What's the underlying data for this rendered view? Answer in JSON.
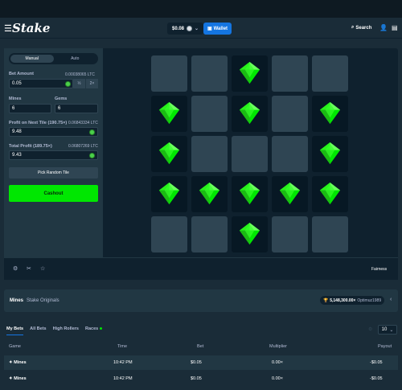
{
  "header": {
    "logo": "Stake",
    "balance": "$0.08",
    "wallet": "Wallet",
    "search": "Search"
  },
  "sidebar": {
    "tabs": [
      "Manual",
      "Auto"
    ],
    "bet_amount_label": "Bet Amount",
    "bet_amount_ltc": "0.00038065 LTC",
    "bet_amount_value": "0.05",
    "half": "½",
    "double": "2×",
    "mines_label": "Mines",
    "mines_value": "6",
    "gems_label": "Gems",
    "gems_value": "6",
    "next_label": "Profit on Next Tile (190.75×)",
    "next_ltc": "0.06843334 LTC",
    "next_value": "9.48",
    "total_label": "Total Profit (189.75×)",
    "total_ltc": "0.06807269 LTC",
    "total_value": "9.43",
    "pick_random": "Pick Random Tile",
    "cashout": "Cashout"
  },
  "grid": [
    [
      0,
      0,
      1,
      0,
      0
    ],
    [
      1,
      0,
      1,
      0,
      1
    ],
    [
      1,
      0,
      0,
      0,
      1
    ],
    [
      1,
      1,
      1,
      1,
      1
    ],
    [
      0,
      0,
      1,
      0,
      0
    ]
  ],
  "footer": {
    "fairness": "Fairness"
  },
  "info": {
    "title": "Mines",
    "subtitle": "Stake Originals",
    "amount": "5,148,300.00×",
    "user": "Optimuz1989"
  },
  "bets": {
    "tabs": [
      "My Bets",
      "All Bets",
      "High Rollers",
      "Races"
    ],
    "rows_per_page": "10",
    "headers": [
      "Game",
      "Time",
      "Bet",
      "Multiplier",
      "Payout"
    ],
    "rows": [
      {
        "game": "Mines",
        "time": "10:42 PM",
        "bet": "$0.05",
        "multiplier": "0.00×",
        "payout": "-$0.05"
      },
      {
        "game": "Mines",
        "time": "10:42 PM",
        "bet": "$0.05",
        "multiplier": "0.00×",
        "payout": "-$0.05"
      }
    ]
  },
  "colors": {
    "accent": "#00e701",
    "brand": "#1475e1",
    "panel": "#213743",
    "board": "#0f212e"
  }
}
